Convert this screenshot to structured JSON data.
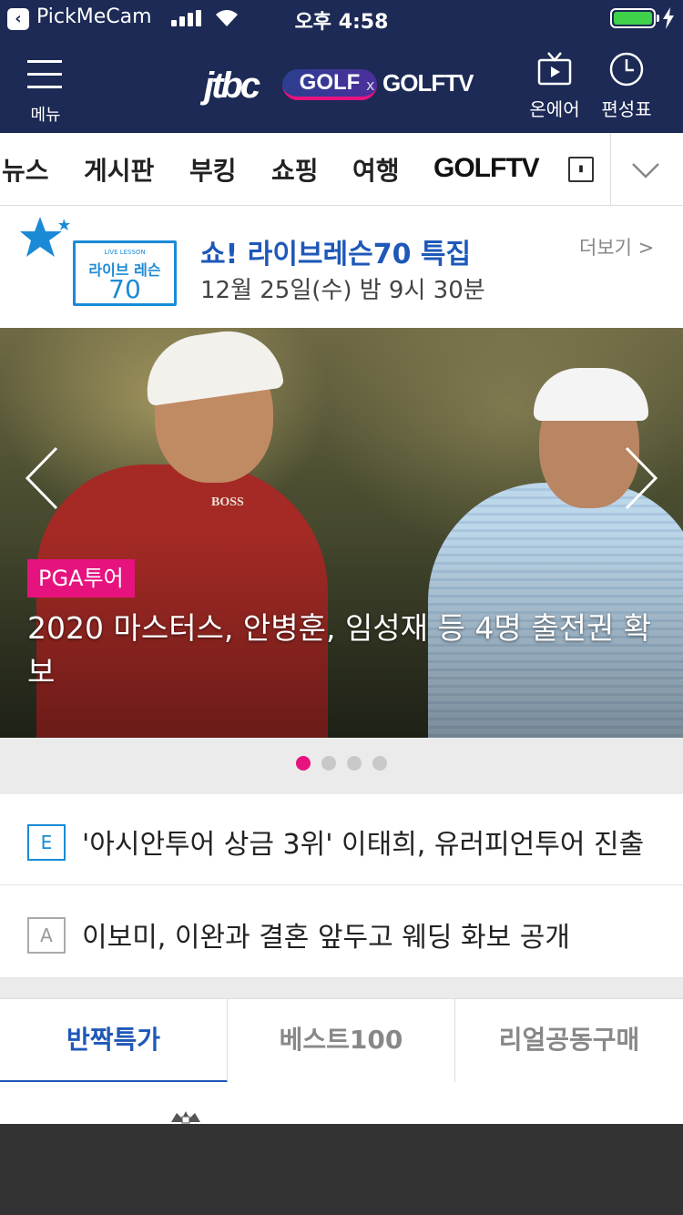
{
  "status_bar": {
    "back_app": "PickMeCam",
    "time": "오후 4:58",
    "battery_level": 1.0,
    "battery_color": "#3fd14a"
  },
  "header": {
    "menu_label": "메뉴",
    "logo_jtbc": "jtbc",
    "logo_golf": "GOLF",
    "logo_x": "x",
    "logo_golftv": "GOLFTV",
    "onair_label": "온에어",
    "schedule_label": "편성표",
    "bg_color": "#1c2a55"
  },
  "category_nav": {
    "items": [
      "뉴스",
      "게시판",
      "부킹",
      "쇼핑",
      "여행"
    ],
    "golftv_label": "GOLFTV"
  },
  "promo": {
    "logo_small": "LIVE LESSON",
    "logo_mid": "라이브 레슨",
    "logo_num": "70",
    "title": "쇼! 라이브레슨70 특집",
    "date": "12월 25일(수) 밤 9시 30분",
    "more": "더보기 >"
  },
  "hero": {
    "tag": "PGA투어",
    "headline": "2020 마스터스, 안병훈, 임성재 등 4명 출전권 확보",
    "shirt_logo": "BOSS",
    "slide_count": 4,
    "active_slide": 1,
    "accent_color": "#e6137f"
  },
  "news": [
    {
      "badge": "E",
      "text": "'아시안투어 상금 3위' 이태희, 유러피언투어 진출"
    },
    {
      "badge": "A",
      "text": "이보미, 이완과 결혼 앞두고 웨딩 화보 공개"
    }
  ],
  "shop_tabs": [
    {
      "label": "반짝특가",
      "active": true
    },
    {
      "label": "베스트100",
      "active": false
    },
    {
      "label": "리얼공동구매",
      "active": false
    }
  ]
}
